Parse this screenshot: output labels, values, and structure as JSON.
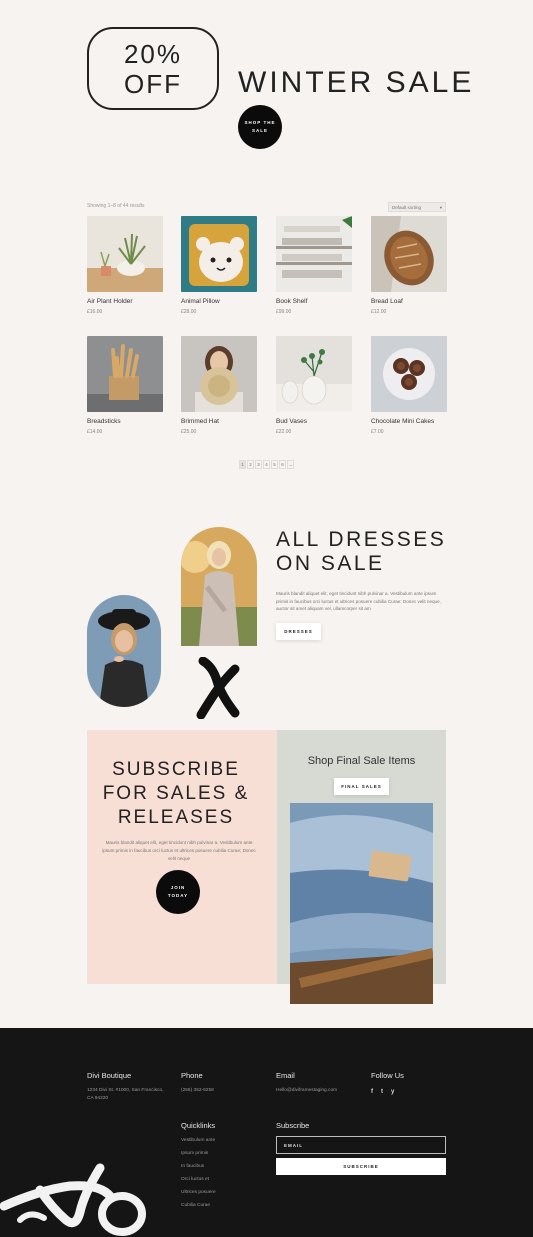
{
  "hero": {
    "badge_line1": "20%",
    "badge_line2": "OFF",
    "title": "WINTER SALE",
    "shop_line1": "SHOP THE",
    "shop_line2": "SALE"
  },
  "shop": {
    "results_text": "Showing 1–8 of 44 results",
    "sort_label": "Default sorting",
    "products": [
      {
        "name": "Air Plant Holder",
        "price": "£16.00"
      },
      {
        "name": "Animal Pillow",
        "price": "£28.00"
      },
      {
        "name": "Book Shelf",
        "price": "£99.00"
      },
      {
        "name": "Bread Loaf",
        "price": "£12.00"
      },
      {
        "name": "Breadsticks",
        "price": "£14.00"
      },
      {
        "name": "Brimmed Hat",
        "price": "£25.00"
      },
      {
        "name": "Bud Vases",
        "price": "£22.00"
      },
      {
        "name": "Chocolate Mini Cakes",
        "price": "£7.00"
      }
    ],
    "pages": [
      "1",
      "2",
      "3",
      "4",
      "5",
      "6",
      "→"
    ]
  },
  "dresses": {
    "title_line1": "ALL DRESSES",
    "title_line2": "ON SALE",
    "body": "Mauris blandit aliquet elit, eget tincidunt nibh pulvinar a. Vestibulum ante ipsum primis in faucibus orci luctus et ultrices posuere cubilia Curae; Donec velit neque, auctor sit amet aliquam vel, ullamcorper sit am",
    "button": "DRESSES"
  },
  "subscribe": {
    "title_line1": "SUBSCRIBE",
    "title_line2": "FOR SALES &",
    "title_line3": "RELEASES",
    "body": "Mauris blandit aliquet elit, eget tincidunt nibh pulvinar a. Vestibulum ante ipsum primis in faucibus orci luctus et ultrices posuere cubilia Curae; Donec velit neque",
    "join_line1": "JOIN",
    "join_line2": "TODAY",
    "final_title": "Shop Final Sale Items",
    "final_button": "FINAL SALES"
  },
  "footer": {
    "brand": "Divi Boutique",
    "address_line1": "1234 Divi St. #1000, San Francisco,",
    "address_line2": "CA 94220",
    "phone_head": "Phone",
    "phone": "(255) 352-6258",
    "email_head": "Email",
    "email": "Hello@diviframestaging.com",
    "follow_head": "Follow Us",
    "social": [
      "f",
      "t",
      "y"
    ],
    "quicklinks_head": "Quicklinks",
    "quicklinks": [
      "Vestibulum ante",
      "Ipsum primis",
      "In faucibus",
      "Orci luctus et",
      "Ultrices posuere",
      "Cubilia Curae"
    ],
    "subscribe_head": "Subscribe",
    "email_placeholder": "EMAIL",
    "subscribe_button": "SUBSCRIBE"
  },
  "colors": {
    "page_bg": "#f7f3f0",
    "subscribe_pink": "#f7dfd6",
    "sale_gray": "#d7d9d3",
    "footer_bg": "#151515",
    "ink": "#0b0b0b"
  }
}
